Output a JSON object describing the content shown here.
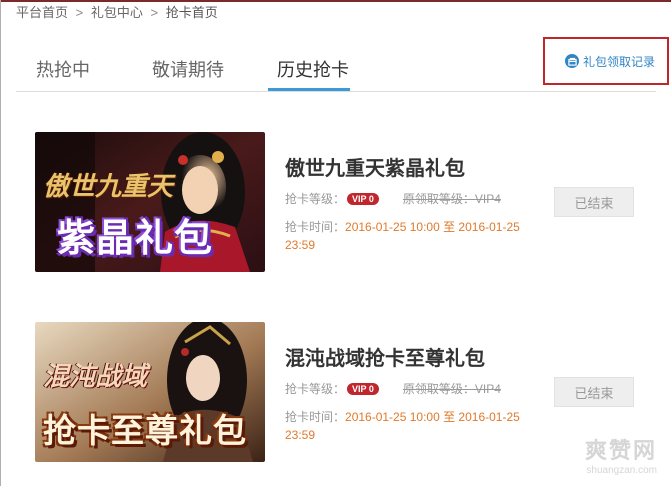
{
  "breadcrumb": {
    "items": [
      "平台首页",
      "礼包中心",
      "抢卡首页"
    ],
    "separator": ">"
  },
  "tabs": [
    {
      "label": "热抢中",
      "active": false
    },
    {
      "label": "敬请期待",
      "active": false
    },
    {
      "label": "历史抢卡",
      "active": true
    }
  ],
  "record_link": {
    "label": "礼包领取记录",
    "icon": "box-icon"
  },
  "cards": [
    {
      "banner_logo": "傲世九重天",
      "banner_text": "紫晶礼包",
      "title": "傲世九重天紫晶礼包",
      "level_label": "抢卡等级：",
      "vip_badge": "VIP 0",
      "orig_level": "原领取等级：VIP4",
      "time_label": "抢卡时间：",
      "time_value": "2016-01-25 10:00 至 2016-01-25 23:59",
      "status_button": "已结束"
    },
    {
      "banner_logo": "混沌战域",
      "banner_text": "抢卡至尊礼包",
      "title": "混沌战域抢卡至尊礼包",
      "level_label": "抢卡等级：",
      "vip_badge": "VIP 0",
      "orig_level": "原领取等级：VIP4",
      "time_label": "抢卡时间：",
      "time_value": "2016-01-25 10:00 至 2016-01-25 23:59",
      "status_button": "已结束"
    }
  ],
  "watermark": {
    "main": "爽赞网",
    "sub": "shuangzan.com"
  },
  "colors": {
    "accent_blue": "#3a9bd8",
    "link_blue": "#2f86c5",
    "highlight_red": "#c0272d",
    "time_orange": "#e07a2c"
  }
}
